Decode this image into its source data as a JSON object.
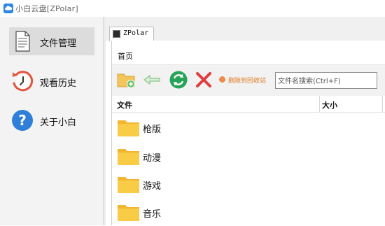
{
  "window": {
    "title": "小白云盘[ZPolar]"
  },
  "sidebar": {
    "items": [
      {
        "label": "文件管理",
        "icon": "document-icon",
        "active": true
      },
      {
        "label": "观看历史",
        "icon": "history-clock-icon",
        "active": false
      },
      {
        "label": "关于小白",
        "icon": "question-icon",
        "active": false
      }
    ]
  },
  "tabs": [
    {
      "label": "ZPolar"
    }
  ],
  "breadcrumb": "首页",
  "toolbar": {
    "new_folder_icon": "new-folder-icon",
    "back_icon": "back-arrow-icon",
    "refresh_icon": "refresh-icon",
    "delete_icon": "delete-x-icon",
    "delete_to_recycle": "删除到回收站",
    "search_placeholder": "文件名搜索(Ctrl+F)"
  },
  "table": {
    "columns": [
      "文件",
      "大小"
    ],
    "rows": [
      {
        "name": "枪版",
        "icon": "folder-icon"
      },
      {
        "name": "动漫",
        "icon": "folder-icon"
      },
      {
        "name": "游戏",
        "icon": "folder-icon"
      },
      {
        "name": "音乐",
        "icon": "folder-icon"
      }
    ]
  },
  "colors": {
    "accent_orange": "#e07a20",
    "refresh_green": "#28a35a",
    "delete_red": "#e23c3c",
    "folder_yellow": "#f7c63f",
    "icon_red": "#e2543f",
    "icon_blue": "#2f7fd8"
  }
}
